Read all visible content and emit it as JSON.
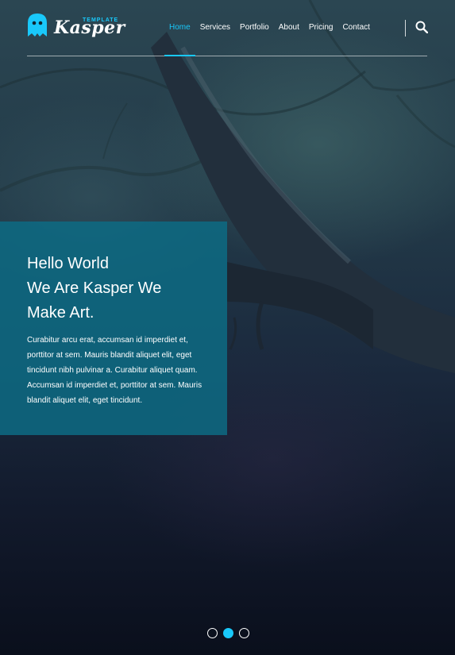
{
  "logo": {
    "name": "Kasper",
    "tagline": "TEMPLATE"
  },
  "nav": {
    "items": [
      {
        "label": "Home",
        "active": true
      },
      {
        "label": "Services",
        "active": false
      },
      {
        "label": "Portfolio",
        "active": false
      },
      {
        "label": "About",
        "active": false
      },
      {
        "label": "Pricing",
        "active": false
      },
      {
        "label": "Contact",
        "active": false
      }
    ],
    "search_icon": "search-icon"
  },
  "hero": {
    "headline_lines": [
      "Hello World",
      "We Are Kasper We",
      "Make Art."
    ],
    "paragraph": "Curabitur arcu erat, accumsan id imperdiet et, porttitor at sem. Mauris blandit aliquet elit, eget tincidunt nibh pulvinar a. Curabitur aliquet quam. Accumsan id imperdiet et, porttitor at sem. Mauris blandit aliquet elit, eget tincidunt."
  },
  "slider": {
    "count": 3,
    "active_index": 1
  },
  "colors": {
    "accent": "#19c8fa",
    "box": "#0d6b84"
  }
}
